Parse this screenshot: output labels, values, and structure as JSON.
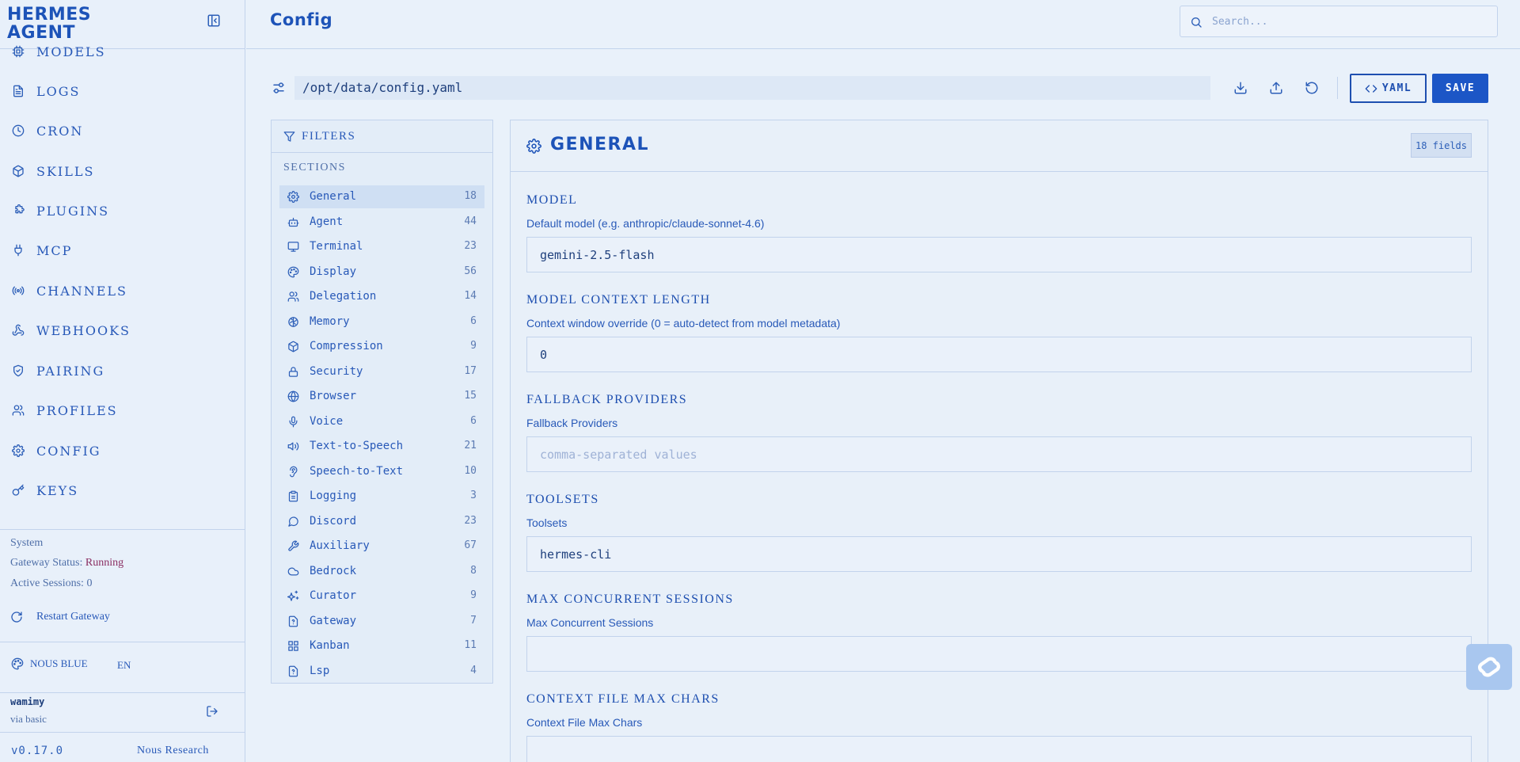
{
  "app": {
    "brand": "HERMES\nAGENT"
  },
  "sidebar": {
    "items": [
      {
        "label": "MODELS",
        "icon": "cpu-icon"
      },
      {
        "label": "LOGS",
        "icon": "file-text-icon"
      },
      {
        "label": "CRON",
        "icon": "clock-icon"
      },
      {
        "label": "SKILLS",
        "icon": "package-icon"
      },
      {
        "label": "PLUGINS",
        "icon": "puzzle-icon"
      },
      {
        "label": "MCP",
        "icon": "plug-icon"
      },
      {
        "label": "CHANNELS",
        "icon": "radio-icon"
      },
      {
        "label": "WEBHOOKS",
        "icon": "webhook-icon"
      },
      {
        "label": "PAIRING",
        "icon": "shield-check-icon"
      },
      {
        "label": "PROFILES",
        "icon": "users-icon"
      },
      {
        "label": "CONFIG",
        "icon": "gear-icon"
      },
      {
        "label": "KEYS",
        "icon": "key-icon"
      }
    ],
    "system": {
      "title": "System",
      "status_label": "Gateway Status: ",
      "status_value": "Running",
      "sessions_label": "Active Sessions: ",
      "sessions_value": "0",
      "restart_label": "Restart Gateway"
    },
    "theme_label": "NOUS BLUE",
    "language": "EN",
    "user": {
      "name": "wamimy",
      "sub": "via basic"
    },
    "version": "v0.17.0",
    "org": "Nous Research"
  },
  "header": {
    "title": "Config",
    "search_placeholder": "Search..."
  },
  "toolbar": {
    "file_path": "/opt/data/config.yaml",
    "yaml_label": "YAML",
    "save_label": "SAVE"
  },
  "filters": {
    "title": "FILTERS",
    "sections_label": "SECTIONS",
    "sections": [
      {
        "label": "General",
        "count": "18",
        "icon": "gear-icon",
        "active": true
      },
      {
        "label": "Agent",
        "count": "44",
        "icon": "bot-icon"
      },
      {
        "label": "Terminal",
        "count": "23",
        "icon": "monitor-icon"
      },
      {
        "label": "Display",
        "count": "56",
        "icon": "palette-icon"
      },
      {
        "label": "Delegation",
        "count": "14",
        "icon": "users-icon"
      },
      {
        "label": "Memory",
        "count": "6",
        "icon": "brain-icon"
      },
      {
        "label": "Compression",
        "count": "9",
        "icon": "package-icon"
      },
      {
        "label": "Security",
        "count": "17",
        "icon": "lock-icon"
      },
      {
        "label": "Browser",
        "count": "15",
        "icon": "globe-icon"
      },
      {
        "label": "Voice",
        "count": "6",
        "icon": "mic-icon"
      },
      {
        "label": "Text-to-Speech",
        "count": "21",
        "icon": "volume-icon"
      },
      {
        "label": "Speech-to-Text",
        "count": "10",
        "icon": "ear-icon"
      },
      {
        "label": "Logging",
        "count": "3",
        "icon": "clipboard-icon"
      },
      {
        "label": "Discord",
        "count": "23",
        "icon": "message-circle-icon"
      },
      {
        "label": "Auxiliary",
        "count": "67",
        "icon": "wrench-icon"
      },
      {
        "label": "Bedrock",
        "count": "8",
        "icon": "cloud-icon"
      },
      {
        "label": "Curator",
        "count": "9",
        "icon": "sparkles-icon"
      },
      {
        "label": "Gateway",
        "count": "7",
        "icon": "file-question-icon"
      },
      {
        "label": "Kanban",
        "count": "11",
        "icon": "grid-icon"
      },
      {
        "label": "Lsp",
        "count": "4",
        "icon": "file-question-icon"
      }
    ]
  },
  "general": {
    "title": "GENERAL",
    "fields_badge": "18 fields",
    "fields": [
      {
        "title": "MODEL",
        "desc": "Default model (e.g. anthropic/claude-sonnet-4.6)",
        "value": "gemini-2.5-flash",
        "placeholder": ""
      },
      {
        "title": "MODEL CONTEXT LENGTH",
        "desc": "Context window override (0 = auto-detect from model metadata)",
        "value": "0",
        "placeholder": ""
      },
      {
        "title": "FALLBACK PROVIDERS",
        "desc": "Fallback Providers",
        "value": "",
        "placeholder": "comma-separated values"
      },
      {
        "title": "TOOLSETS",
        "desc": "Toolsets",
        "value": "hermes-cli",
        "placeholder": ""
      },
      {
        "title": "MAX CONCURRENT SESSIONS",
        "desc": "Max Concurrent Sessions",
        "value": "",
        "placeholder": ""
      },
      {
        "title": "CONTEXT FILE MAX CHARS",
        "desc": "Context File Max Chars",
        "value": "",
        "placeholder": ""
      }
    ]
  },
  "colors": {
    "accent": "#1c56c6",
    "text": "#1e4fb0",
    "status_running": "#8a2e62",
    "background": "#e9f1fa"
  }
}
